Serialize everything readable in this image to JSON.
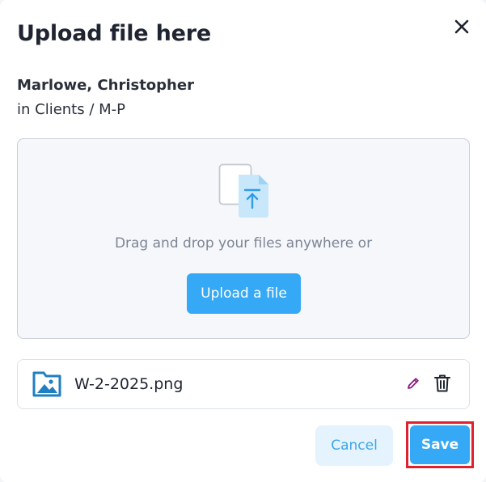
{
  "modal": {
    "title": "Upload file here",
    "close_icon": "close-icon"
  },
  "client": {
    "name": "Marlowe, Christopher",
    "path": "in Clients / M-P"
  },
  "dropzone": {
    "icon": "file-upload-icon",
    "text": "Drag and drop your files anywhere or",
    "upload_label": "Upload a file"
  },
  "file": {
    "icon": "image-file-icon",
    "name": "W-2-2025.png",
    "edit_icon": "pencil-icon",
    "delete_icon": "trash-icon"
  },
  "actions": {
    "cancel_label": "Cancel",
    "save_label": "Save"
  },
  "colors": {
    "accent": "#35a9f5",
    "cancel_bg": "#e4f3fd",
    "highlight": "#e0202e",
    "edit_icon": "#8b1a7a"
  }
}
